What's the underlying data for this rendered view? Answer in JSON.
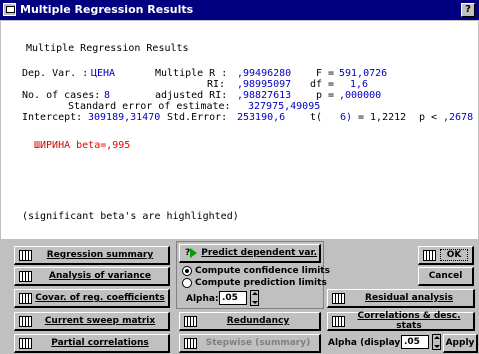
{
  "title": "Multiple Regression Results",
  "help_label": "?",
  "output": {
    "heading": "Multiple Regression Results",
    "dep_var_label": "Dep. Var. :",
    "dep_var_value": "ЦЕНА",
    "mult_r_label": "Multiple R :",
    "mult_r_value": ",99496280",
    "f_label": "F =",
    "f_value": "591,0726",
    "r2_label": "RI:",
    "r2_value": ",98995097",
    "df_label": "df =",
    "df_value": "1,6",
    "cases_label": "No. of cases:",
    "cases_value": "8",
    "adj_r2_label": "adjusted RI:",
    "adj_r2_value": ",98827613",
    "p_label": "p =",
    "p_value": ",000000",
    "std_err_label": "Standard error of estimate:",
    "std_err_value": "327975,49095",
    "intercept_label": "Intercept:",
    "intercept_value": "309189,31470",
    "int_std_err_label": "Std.Error:",
    "int_std_err_value": "253190,6",
    "t_label": "t(",
    "t_df": "6)",
    "t_eq": "= 1,2212",
    "pt_label": "p <",
    "pt_value": ",2678",
    "beta_line": "ШИРИНА beta=,995",
    "note": "(significant beta's are highlighted)"
  },
  "buttons": {
    "regression_summary": "Regression summary",
    "analysis_of_variance": "Analysis of variance",
    "covar": "Covar. of reg. coefficients",
    "current_sweep": "Current sweep matrix",
    "partial_corr": "Partial correlations",
    "predict": "Predict dependent var.",
    "redundancy": "Redundancy",
    "stepwise": "Stepwise (summary)",
    "ok": "OK",
    "cancel": "Cancel",
    "residual": "Residual analysis",
    "correlations": "Correlations & desc. stats",
    "apply": "Apply"
  },
  "options": {
    "conf_limits": "Compute confidence limits",
    "pred_limits": "Compute prediction limits",
    "alpha_label": "Alpha:",
    "alpha_value": ".05",
    "alpha_display_label": "Alpha (display):",
    "alpha_display_value": ".05"
  }
}
